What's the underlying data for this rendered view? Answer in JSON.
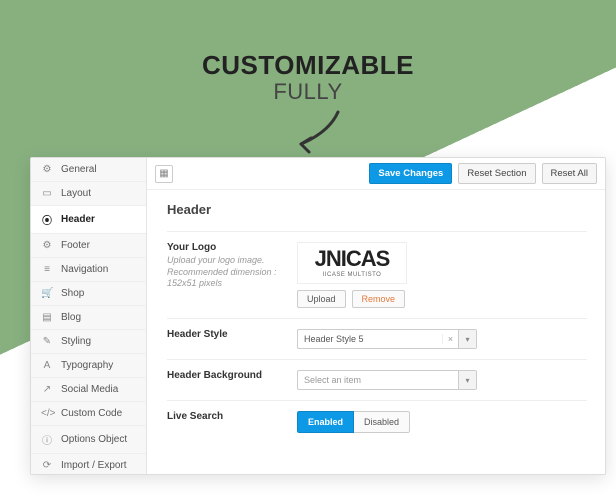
{
  "banner": {
    "line1": "CUSTOMIZABLE",
    "line2": "FULLY"
  },
  "topbar": {
    "save": "Save Changes",
    "reset_section": "Reset Section",
    "reset_all": "Reset All"
  },
  "sidebar": {
    "items": [
      {
        "icon": "⚙",
        "label": "General"
      },
      {
        "icon": "▭",
        "label": "Layout"
      },
      {
        "icon": "⦿",
        "label": "Header"
      },
      {
        "icon": "⚙",
        "label": "Footer"
      },
      {
        "icon": "≡",
        "label": "Navigation"
      },
      {
        "icon": "🛒",
        "label": "Shop"
      },
      {
        "icon": "▤",
        "label": "Blog"
      },
      {
        "icon": "✎",
        "label": "Styling"
      },
      {
        "icon": "A",
        "label": "Typography"
      },
      {
        "icon": "↗",
        "label": "Social Media"
      },
      {
        "icon": "</>",
        "label": "Custom Code"
      },
      {
        "icon": "ⓘ",
        "label": "Options Object"
      },
      {
        "icon": "⟳",
        "label": "Import / Export"
      }
    ],
    "active_index": 2
  },
  "section": {
    "title": "Header",
    "logo": {
      "label": "Your Logo",
      "hint": "Upload your logo image. Recommended dimension : 152x51 pixels",
      "preview_big": "JNICAS",
      "preview_small": "IICASE MULTISTO",
      "upload": "Upload",
      "remove": "Remove"
    },
    "style": {
      "label": "Header Style",
      "value": "Header Style 5"
    },
    "background": {
      "label": "Header Background",
      "placeholder": "Select an item"
    },
    "live_search": {
      "label": "Live Search",
      "on": "Enabled",
      "off": "Disabled"
    }
  }
}
